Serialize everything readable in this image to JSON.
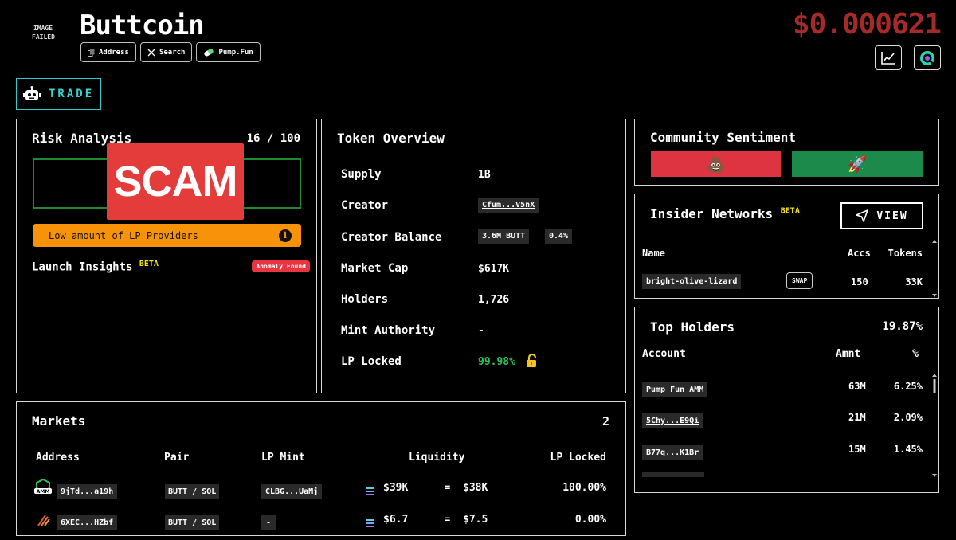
{
  "header": {
    "image_failed": "IMAGE FAILED",
    "token_name": "Buttcoin",
    "chips": [
      {
        "label": "Address",
        "icon": "copy-icon"
      },
      {
        "label": "Search",
        "icon": "x-logo-icon"
      },
      {
        "label": "Pump.Fun",
        "icon": "pill-icon"
      }
    ],
    "price": "$0.000621",
    "trade_label": "TRADE"
  },
  "risk": {
    "title": "Risk Analysis",
    "score": "16 / 100",
    "stamp": "SCAM",
    "warning": "Low amount of LP Providers",
    "warning_icon": "i",
    "launch_insights": "Launch Insights",
    "beta": "BETA",
    "anomaly": "Anomaly Found"
  },
  "overview": {
    "title": "Token Overview",
    "supply_label": "Supply",
    "supply": "1B",
    "creator_label": "Creator",
    "creator": "Cfum...V5nX",
    "creator_balance_label": "Creator Balance",
    "creator_balance": "3.6M BUTT",
    "creator_pct": "0.4%",
    "market_cap_label": "Market Cap",
    "market_cap": "$617K",
    "holders_label": "Holders",
    "holders": "1,726",
    "mint_label": "Mint Authority",
    "mint": "-",
    "lp_locked_label": "LP Locked",
    "lp_locked": "99.98%",
    "lp_locked_color": "#2fbf55"
  },
  "markets": {
    "title": "Markets",
    "count": "2",
    "headers": [
      "Address",
      "Pair",
      "LP Mint",
      "Liquidity",
      "LP Locked"
    ],
    "rows": [
      {
        "address": "9jTd...a19h",
        "base": "BUTT",
        "sep": "/",
        "quote": "SOL",
        "lp_mint": "CLBG...UaMj",
        "liq_a": "$39K",
        "eq": "=",
        "liq_b": "$38K",
        "locked": "100.00%"
      },
      {
        "address": "6XEC...HZbf",
        "base": "BUTT",
        "sep": "/",
        "quote": "SOL",
        "lp_mint": "-",
        "liq_a": "$6.7",
        "eq": "=",
        "liq_b": "$7.5",
        "locked": "0.00%"
      }
    ],
    "amm_badge": "AMM"
  },
  "sentiment": {
    "title": "Community Sentiment",
    "bad_emoji": "💩",
    "good_emoji": "🚀"
  },
  "insiders": {
    "title": "Insider Networks",
    "beta": "BETA",
    "view_label": "VIEW",
    "headers": [
      "Name",
      "Accs",
      "Tokens"
    ],
    "rows": [
      {
        "name": "bright-olive-lizard",
        "swap": "SWAP",
        "accs": "150",
        "tokens": "33K"
      }
    ]
  },
  "holders": {
    "title": "Top Holders",
    "total": "19.87%",
    "headers": [
      "Account",
      "Amnt",
      "%"
    ],
    "rows": [
      {
        "account": "Pump Fun AMM",
        "amount": "63M",
        "pct": "6.25%"
      },
      {
        "account": "5Chy...E9Qi",
        "amount": "21M",
        "pct": "2.09%"
      },
      {
        "account": "B77q...K1Br",
        "amount": "15M",
        "pct": "1.45%"
      }
    ]
  }
}
